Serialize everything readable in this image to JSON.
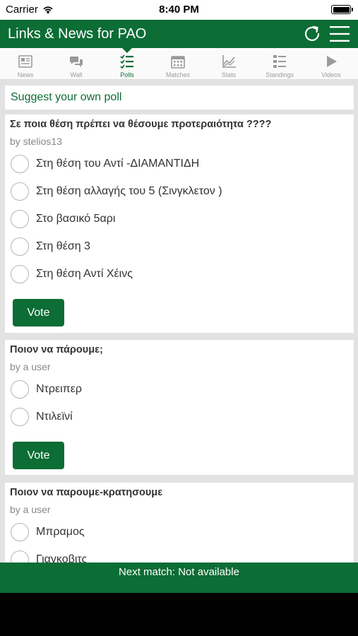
{
  "status": {
    "carrier": "Carrier",
    "time": "8:40 PM"
  },
  "header": {
    "title": "Links & News for PAO"
  },
  "tabs": [
    {
      "label": "News",
      "icon": "news-icon"
    },
    {
      "label": "Wall",
      "icon": "wall-icon"
    },
    {
      "label": "Polls",
      "icon": "polls-icon",
      "active": true
    },
    {
      "label": "Matches",
      "icon": "calendar-icon"
    },
    {
      "label": "Stats",
      "icon": "stats-icon"
    },
    {
      "label": "Standings",
      "icon": "standings-icon"
    },
    {
      "label": "Videos",
      "icon": "play-icon"
    }
  ],
  "suggest": "Suggest your own poll",
  "polls": [
    {
      "question": "Σε ποια θέση πρέπει να θέσουμε προτεραιότητα ????",
      "author": "by stelios13",
      "options": [
        "Στη θέση του Αντί -ΔΙΑΜΑΝΤΙΔΗ",
        "Στη θέση αλλαγής του 5 (Σινγκλετον )",
        "Στο βασικό 5αρι",
        "Στη θέση 3",
        "Στη θέση Αντί Χέινς"
      ],
      "vote_label": "Vote"
    },
    {
      "question": "Ποιον να πάρουμε;",
      "author": "by a user",
      "options": [
        "Ντρειπερ",
        "Ντιλεϊνί"
      ],
      "vote_label": "Vote"
    },
    {
      "question": "Ποιον να παρουμε-κρατησουμε",
      "author": "by a user",
      "options": [
        "Μπραμος",
        "Γιαγκοβιτς"
      ]
    }
  ],
  "footer": {
    "next_match": "Next match: Not available"
  },
  "colors": {
    "brand": "#0c6d35",
    "background": "#e2e2e2"
  }
}
